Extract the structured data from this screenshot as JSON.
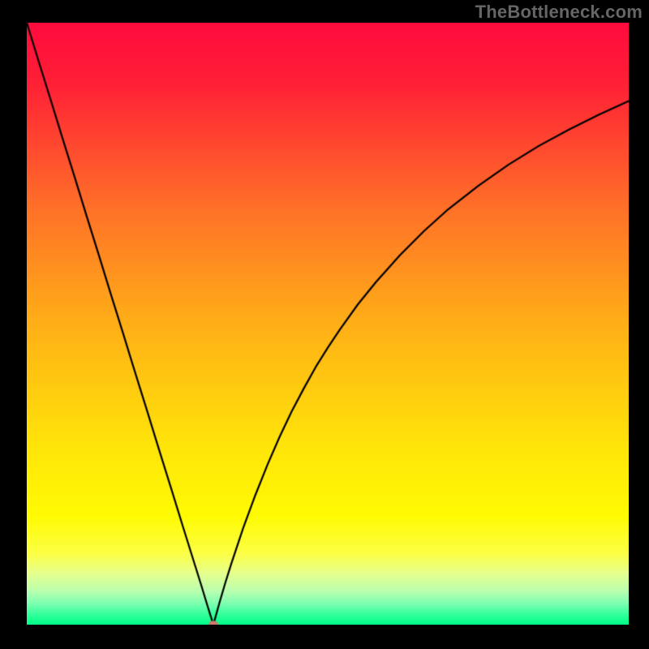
{
  "watermark": "TheBottleneck.com",
  "chart_data": {
    "type": "line",
    "title": "",
    "xlabel": "",
    "ylabel": "",
    "xlim": [
      0,
      100
    ],
    "ylim": [
      0,
      100
    ],
    "axes_visible": false,
    "legend": false,
    "plot_background": {
      "type": "vertical_gradient",
      "stops": [
        {
          "pos": 0.0,
          "color": "#ff0b3e"
        },
        {
          "pos": 0.1,
          "color": "#ff2036"
        },
        {
          "pos": 0.3,
          "color": "#ff6e29"
        },
        {
          "pos": 0.5,
          "color": "#ffaf17"
        },
        {
          "pos": 0.7,
          "color": "#ffe40a"
        },
        {
          "pos": 0.82,
          "color": "#fffb03"
        },
        {
          "pos": 0.882,
          "color": "#fcff45"
        },
        {
          "pos": 0.915,
          "color": "#e6ff8f"
        },
        {
          "pos": 0.945,
          "color": "#b8ffb0"
        },
        {
          "pos": 0.965,
          "color": "#7cffb0"
        },
        {
          "pos": 0.985,
          "color": "#2dff9a"
        },
        {
          "pos": 1.0,
          "color": "#00ff85"
        }
      ]
    },
    "curve_color": "#000000",
    "curve_width": 2.2,
    "minimum_marker": {
      "x": 31.0,
      "y": 0.0,
      "color": "#cd7a6f",
      "rx": 6,
      "ry": 4.8
    },
    "series": [
      {
        "name": "bottleneck-curve",
        "x": [
          0,
          2,
          4,
          6,
          8,
          10,
          12,
          14,
          16,
          18,
          20,
          22,
          24,
          26,
          28,
          29,
          30,
          30.5,
          31,
          31.5,
          32,
          33,
          34,
          35,
          36,
          38,
          40,
          42,
          44,
          46,
          48,
          50,
          52,
          55,
          58,
          62,
          66,
          70,
          75,
          80,
          85,
          90,
          95,
          100
        ],
        "y": [
          100,
          93.5,
          87.1,
          80.6,
          74.2,
          67.7,
          61.3,
          54.8,
          48.4,
          41.9,
          35.5,
          29.0,
          22.6,
          16.1,
          9.7,
          6.5,
          3.2,
          1.6,
          0.0,
          1.8,
          3.6,
          7.0,
          10.2,
          13.2,
          16.2,
          21.6,
          26.6,
          31.2,
          35.4,
          39.2,
          42.8,
          46.0,
          49.0,
          53.2,
          56.9,
          61.4,
          65.4,
          69.0,
          72.9,
          76.4,
          79.5,
          82.2,
          84.7,
          87.0
        ]
      }
    ]
  }
}
